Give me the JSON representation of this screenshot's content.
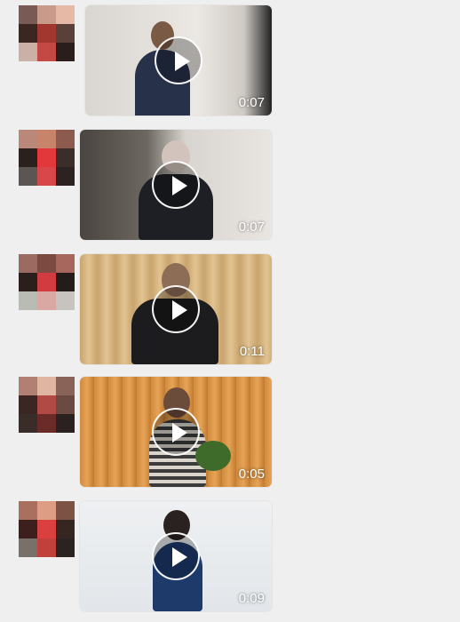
{
  "messages": [
    {
      "avatar_colors": [
        "#7a5a54",
        "#c99a8a",
        "#e6b8a6",
        "#3b2722",
        "#a1372f",
        "#59413a",
        "#cbb0a6",
        "#c34a44",
        "#2a1e1c"
      ],
      "duration": "0:07",
      "icon": "play-icon"
    },
    {
      "avatar_colors": [
        "#b98879",
        "#c8846a",
        "#8c5a4e",
        "#2a211f",
        "#e2383b",
        "#3a2d2a",
        "#5b5653",
        "#d8484a",
        "#2c2222"
      ],
      "duration": "0:07",
      "icon": "play-icon"
    },
    {
      "avatar_colors": [
        "#9b6b62",
        "#7c4a40",
        "#a8675c",
        "#2a1f1d",
        "#d23b3f",
        "#231c1b",
        "#b9bcb5",
        "#d9a8a2",
        "#c7c4c0"
      ],
      "duration": "0:11",
      "icon": "play-icon"
    },
    {
      "avatar_colors": [
        "#b27f73",
        "#e0b5a2",
        "#8a6358",
        "#3b2623",
        "#b14944",
        "#6a4a43",
        "#3a2d29",
        "#6b2b29",
        "#2b2120"
      ],
      "duration": "0:05",
      "icon": "play-icon"
    },
    {
      "avatar_colors": [
        "#a96f5f",
        "#dd9d84",
        "#7c5245",
        "#3d1f1d",
        "#d9403f",
        "#352622",
        "#78706b",
        "#c1403c",
        "#2a2322"
      ],
      "duration": "0:09",
      "icon": "play-icon"
    }
  ]
}
